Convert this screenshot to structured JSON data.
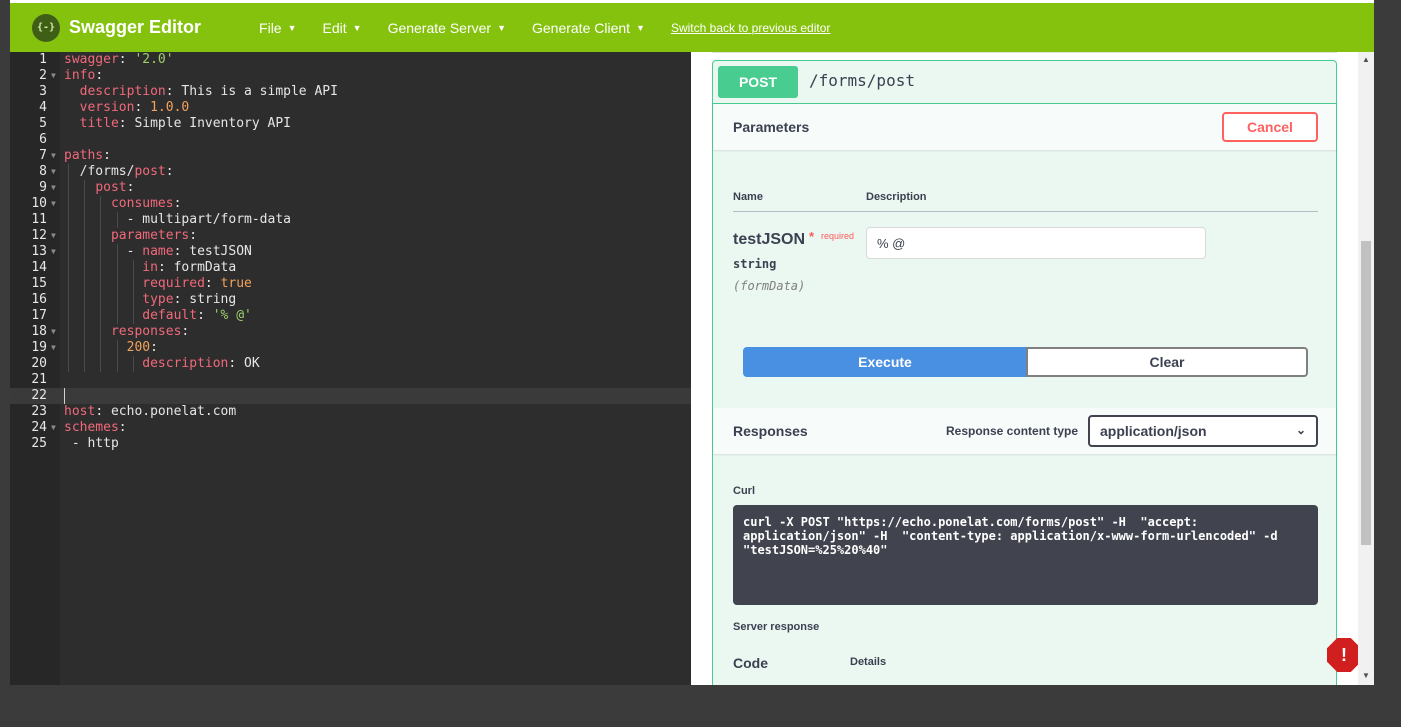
{
  "topbar": {
    "logo_glyph": "{-}",
    "title": "Swagger Editor",
    "menu": [
      {
        "label": "File"
      },
      {
        "label": "Edit"
      },
      {
        "label": "Generate Server"
      },
      {
        "label": "Generate Client"
      }
    ],
    "caret": "▼",
    "switch_link": "Switch back to previous editor",
    "colors": {
      "bar": "#85c20d",
      "logo": "#3f5f17"
    }
  },
  "editor": {
    "lines": [
      "1",
      "2",
      "3",
      "4",
      "5",
      "6",
      "7",
      "8",
      "9",
      "10",
      "11",
      "12",
      "13",
      "14",
      "15",
      "16",
      "17",
      "18",
      "19",
      "20",
      "21",
      "22",
      "23",
      "24",
      "25"
    ],
    "fold_glyph": "▼",
    "t": {
      "swagger_key": "swagger",
      "swagger_val": "'2.0'",
      "info_key": "info",
      "description_key": "description",
      "description_val": "This is a simple API",
      "version_key": "version",
      "version_val": "1.0.0",
      "title_key": "title",
      "title_val": "Simple Inventory API",
      "paths_key": "paths",
      "path_prefix": "/forms/",
      "path_post": "post",
      "post_key": "post",
      "consumes_key": "consumes",
      "consumes_val": "- multipart/form-data",
      "parameters_key": "parameters",
      "dash": "- ",
      "name_key": "name",
      "name_val": "testJSON",
      "in_key": "in",
      "in_val": "formData",
      "required_key": "required",
      "required_val": "true",
      "type_key": "type",
      "type_val": "string",
      "default_key": "default",
      "default_val": "'% @'",
      "responses_key": "responses",
      "code_200": "200",
      "ok_val": "OK",
      "host_key": "host",
      "host_val": "echo.ponelat.com",
      "schemes_key": "schemes",
      "schemes_val": "- http",
      "colon": ":"
    }
  },
  "operation": {
    "method": "POST",
    "path": "/forms/post",
    "parameters_title": "Parameters",
    "cancel_label": "Cancel",
    "col_name": "Name",
    "col_description": "Description",
    "param": {
      "name": "testJSON",
      "required_star": "*",
      "required_label": "required",
      "type": "string",
      "in": "(formData)",
      "value": "% @"
    },
    "execute_label": "Execute",
    "clear_label": "Clear",
    "responses_title": "Responses",
    "response_content_type_label": "Response content type",
    "response_content_type_value": "application/json",
    "select_chevron": "⌄",
    "curl_label": "Curl",
    "curl_command": "curl -X POST \"https://echo.ponelat.com/forms/post\" -H  \"accept: application/json\" -H  \"content-type: application/x-www-form-urlencoded\" -d \"testJSON=%25%20%40\"",
    "server_response_label": "Server response",
    "code_header": "Code",
    "details_header": "Details",
    "colors": {
      "post": "#49cc90",
      "execute": "#4990e2",
      "cancel": "#ff6060",
      "error": "#d11f1f"
    }
  },
  "scrollbar": {
    "up": "▲",
    "down": "▼"
  },
  "error_badge": "!"
}
